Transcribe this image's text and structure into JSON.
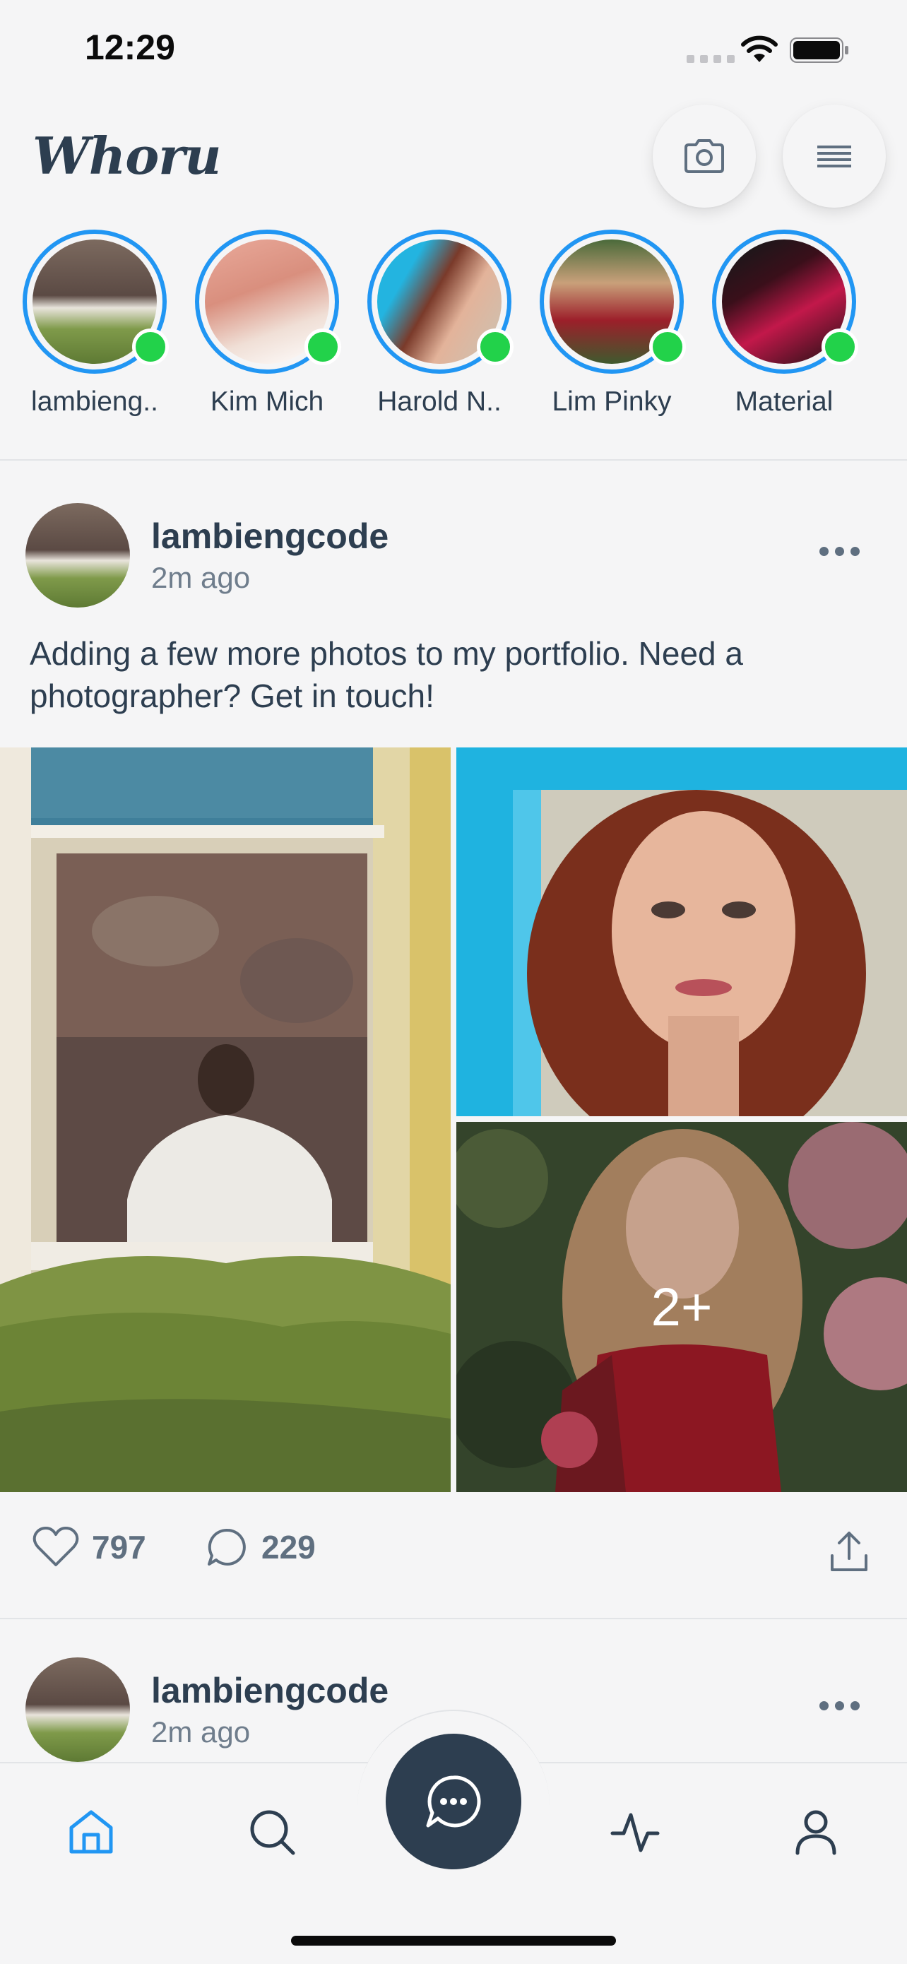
{
  "status_bar": {
    "time": "12:29"
  },
  "header": {
    "app_name": "Whoru",
    "camera_icon": "camera-icon",
    "menu_icon": "menu-icon"
  },
  "stories": [
    {
      "name": "lambieng..",
      "online": true
    },
    {
      "name": "Kim Mich",
      "online": true
    },
    {
      "name": "Harold N..",
      "online": true
    },
    {
      "name": "Lim Pinky",
      "online": true
    },
    {
      "name": "Material",
      "online": true
    }
  ],
  "posts": [
    {
      "author": "lambiengcode",
      "time": "2m ago",
      "text": "Adding a few more photos to my portfolio. Need a photographer? Get in touch!",
      "extra_photos": "2+",
      "likes": "797",
      "comments": "229"
    },
    {
      "author": "lambiengcode",
      "time": "2m ago"
    }
  ],
  "tabbar": {
    "items": [
      "home-icon",
      "search-icon",
      "chat-icon",
      "activity-icon",
      "profile-icon"
    ],
    "active": "home-icon",
    "accent": "#2196f3"
  },
  "colors": {
    "primary": "#2d3e50",
    "accent": "#2196f3",
    "online": "#22d24a"
  }
}
